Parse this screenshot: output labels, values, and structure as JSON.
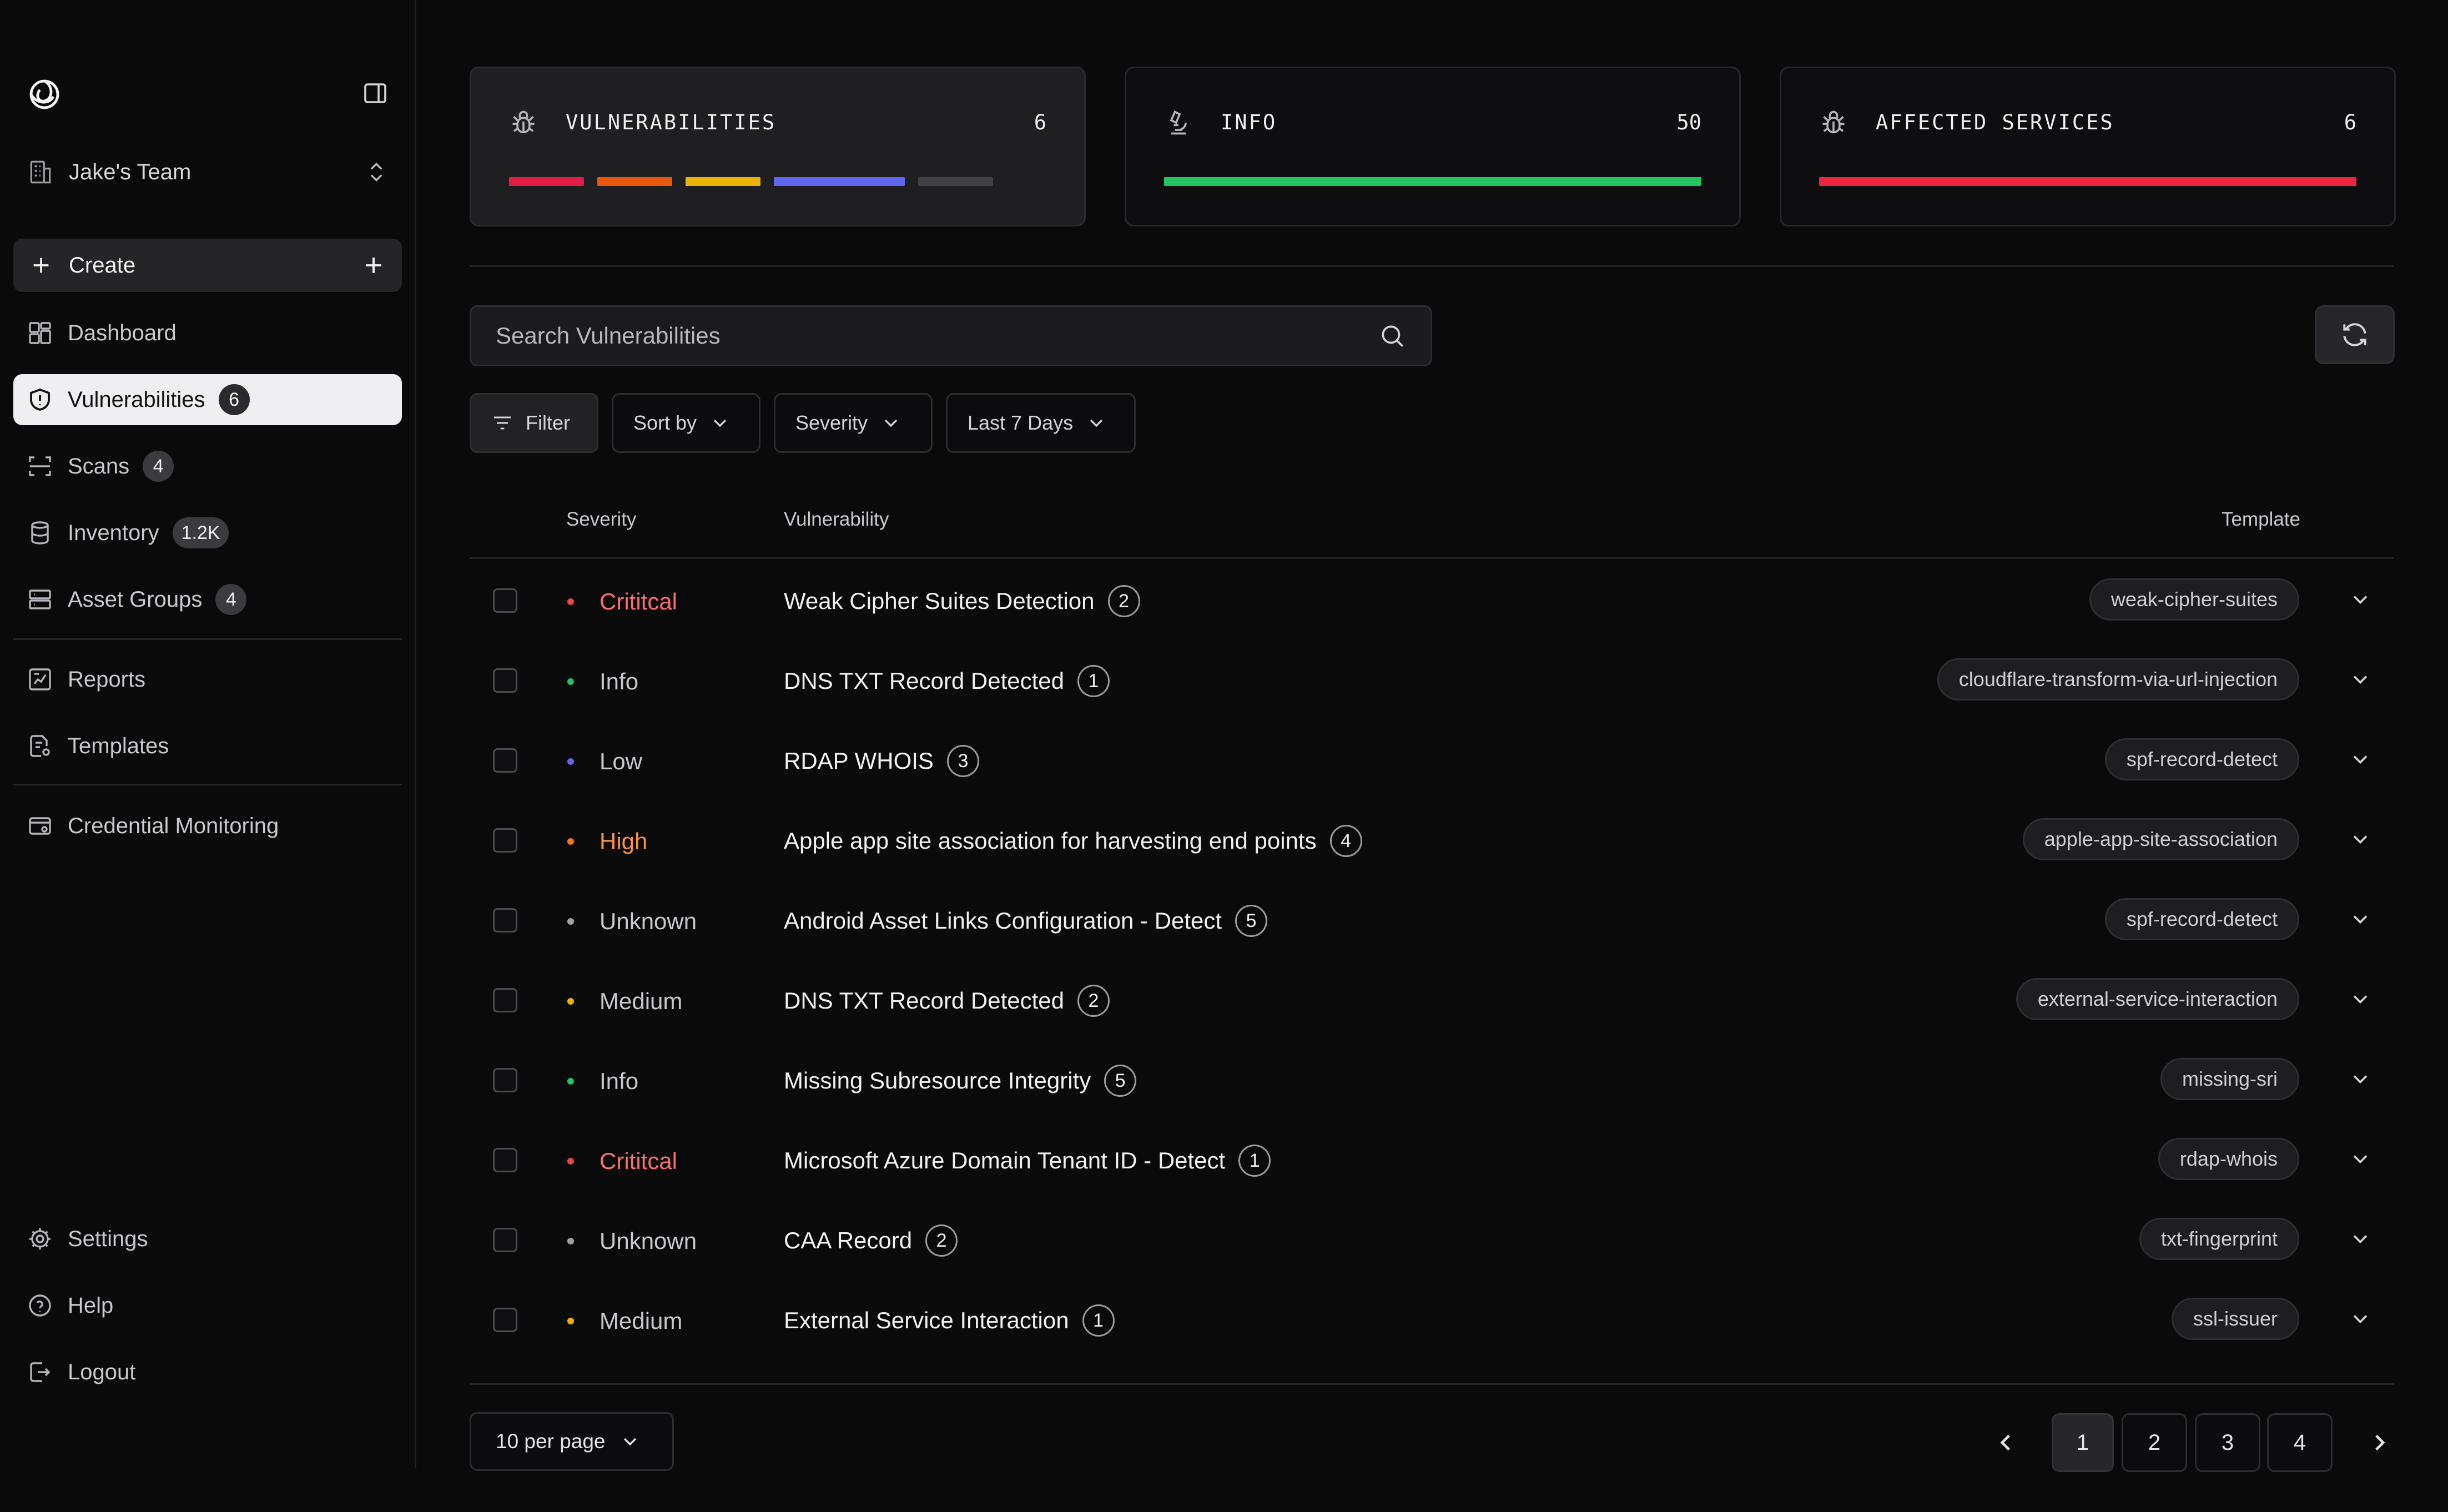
{
  "sidebar": {
    "team_name": "Jake's Team",
    "create_label": "Create",
    "nav": [
      {
        "id": "dashboard",
        "label": "Dashboard",
        "badge": ""
      },
      {
        "id": "vulnerabilities",
        "label": "Vulnerabilities",
        "badge": "6"
      },
      {
        "id": "scans",
        "label": "Scans",
        "badge": "4"
      },
      {
        "id": "inventory",
        "label": "Inventory",
        "badge": "1.2K"
      },
      {
        "id": "asset-groups",
        "label": "Asset Groups",
        "badge": "4"
      },
      {
        "id": "reports",
        "label": "Reports",
        "badge": ""
      },
      {
        "id": "templates",
        "label": "Templates",
        "badge": ""
      },
      {
        "id": "credential-monitoring",
        "label": "Credential Monitoring",
        "badge": ""
      }
    ],
    "bottom": [
      {
        "id": "settings",
        "label": "Settings"
      },
      {
        "id": "help",
        "label": "Help"
      },
      {
        "id": "logout",
        "label": "Logout"
      }
    ]
  },
  "cards": [
    {
      "title": "VULNERABILITIES",
      "count": "6",
      "icon": "bug-icon",
      "segments": [
        {
          "color": "#e11d48",
          "share": 0.155
        },
        {
          "color": "#ea580c",
          "share": 0.155
        },
        {
          "color": "#eab308",
          "share": 0.155
        },
        {
          "color": "#6366f1",
          "share": 0.27
        },
        {
          "color": "#3f3f46",
          "share": 0.155
        }
      ]
    },
    {
      "title": "INFO",
      "count": "50",
      "icon": "microscope-icon",
      "segments": [
        {
          "color": "#22c55e",
          "share": 1.0
        }
      ]
    },
    {
      "title": "AFFECTED SERVICES",
      "count": "6",
      "icon": "bug-icon",
      "segments": [
        {
          "color": "#ef233c",
          "share": 1.0
        }
      ]
    }
  ],
  "search": {
    "placeholder": "Search Vulnerabilities"
  },
  "filters": {
    "filter_label": "Filter",
    "sort_label": "Sort by",
    "severity_label": "Severity",
    "range_label": "Last 7 Days"
  },
  "table": {
    "headers": {
      "severity": "Severity",
      "vulnerability": "Vulnerability",
      "template": "Template"
    },
    "rows": [
      {
        "severity": "Crititcal",
        "level": "critical",
        "name": "Weak Cipher Suites Detection",
        "count": "2",
        "template": "weak-cipher-suites"
      },
      {
        "severity": "Info",
        "level": "info",
        "name": "DNS TXT Record Detected",
        "count": "1",
        "template": "cloudflare-transform-via-url-injection"
      },
      {
        "severity": "Low",
        "level": "low",
        "name": "RDAP WHOIS",
        "count": "3",
        "template": "spf-record-detect"
      },
      {
        "severity": "High",
        "level": "high",
        "name": "Apple app site association for harvesting end points",
        "count": "4",
        "template": "apple-app-site-association"
      },
      {
        "severity": "Unknown",
        "level": "unknown",
        "name": "Android Asset Links Configuration - Detect",
        "count": "5",
        "template": "spf-record-detect"
      },
      {
        "severity": "Medium",
        "level": "medium",
        "name": "DNS TXT Record Detected",
        "count": "2",
        "template": "external-service-interaction"
      },
      {
        "severity": "Info",
        "level": "info",
        "name": "Missing Subresource Integrity",
        "count": "5",
        "template": "missing-sri"
      },
      {
        "severity": "Crititcal",
        "level": "critical",
        "name": "Microsoft Azure Domain Tenant ID - Detect",
        "count": "1",
        "template": "rdap-whois"
      },
      {
        "severity": "Unknown",
        "level": "unknown",
        "name": "CAA Record",
        "count": "2",
        "template": "txt-fingerprint"
      },
      {
        "severity": "Medium",
        "level": "medium",
        "name": "External Service Interaction",
        "count": "1",
        "template": "ssl-issuer"
      }
    ]
  },
  "severity_colors": {
    "critical": {
      "dot": "#ef4444",
      "text": "#f87171"
    },
    "high": {
      "dot": "#f97316",
      "text": "#fb923c"
    },
    "medium": {
      "dot": "#eab308",
      "text": "#c9c9ce"
    },
    "low": {
      "dot": "#6366f1",
      "text": "#c9c9ce"
    },
    "info": {
      "dot": "#22c55e",
      "text": "#c9c9ce"
    },
    "unknown": {
      "dot": "#a1a1aa",
      "text": "#c9c9ce"
    }
  },
  "pagination": {
    "per_page_label": "10 per page",
    "pages": [
      "1",
      "2",
      "3",
      "4"
    ],
    "current": "1"
  }
}
